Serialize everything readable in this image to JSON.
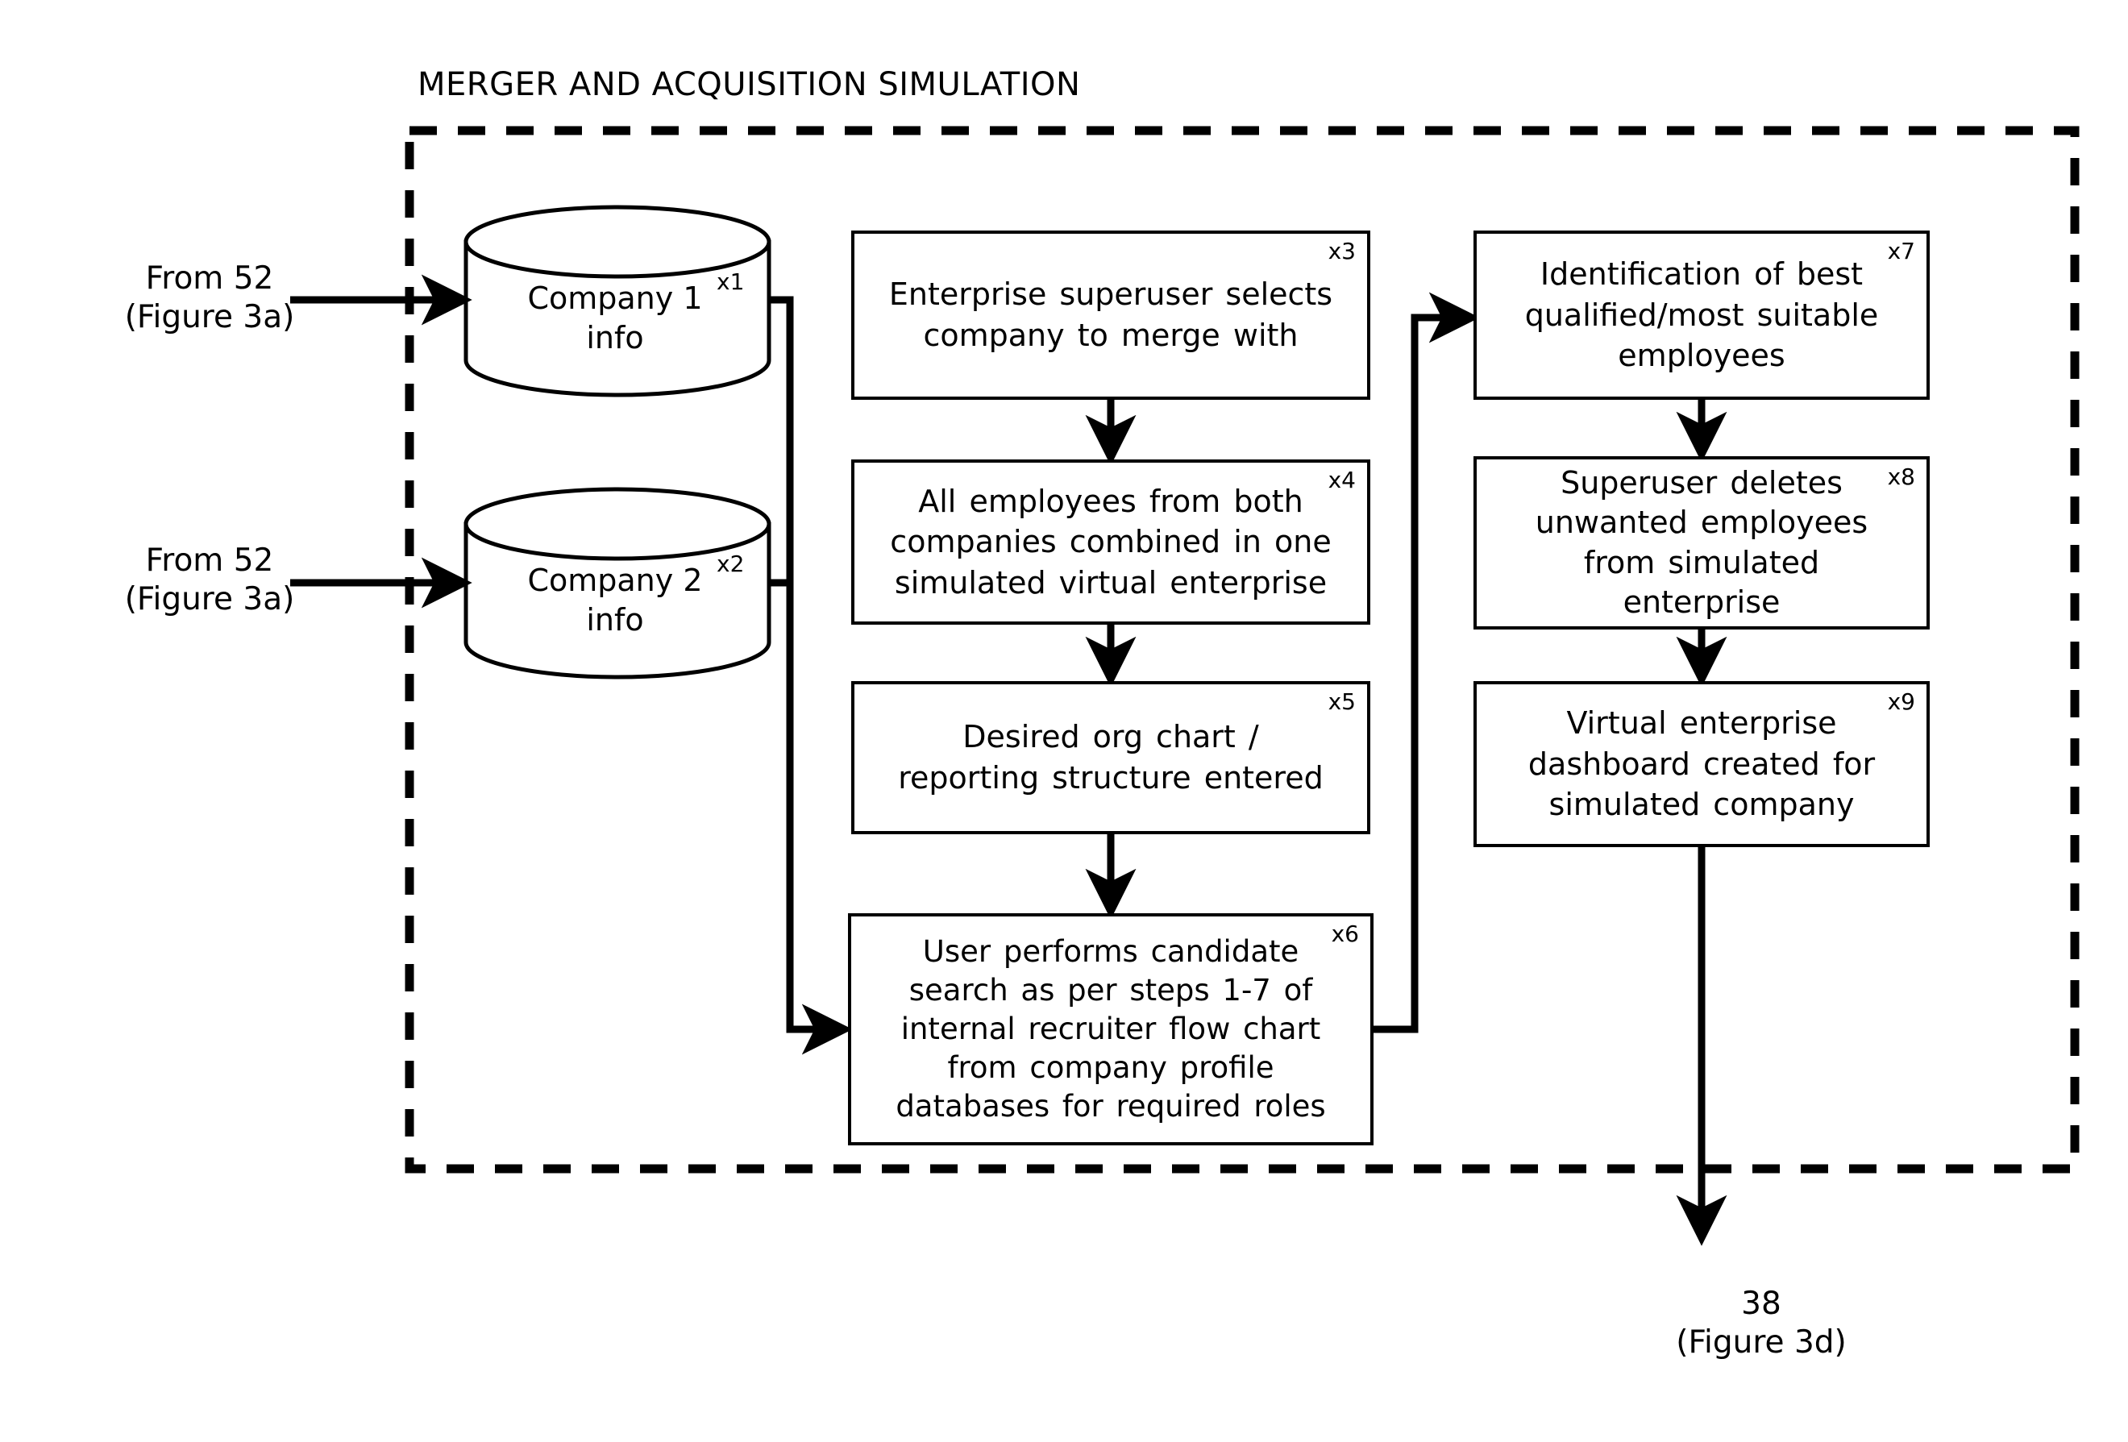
{
  "diagram": {
    "title": "MERGER AND ACQUISITION SIMULATION",
    "type": "flowchart",
    "colors": {
      "line": "#000000",
      "background": "#ffffff",
      "text": "#000000"
    }
  },
  "offpage": {
    "from_top": {
      "line1": "From 52",
      "line2": "(Figure 3a)"
    },
    "from_bottom": {
      "line1": "From 52",
      "line2": "(Figure 3a)"
    },
    "to_next": {
      "line1": "38",
      "line2": "(Figure 3d)"
    }
  },
  "datastores": [
    {
      "id": "x1",
      "ref": "x1",
      "label": "Company 1\ninfo"
    },
    {
      "id": "x2",
      "ref": "x2",
      "label": "Company 2\ninfo"
    }
  ],
  "steps": [
    {
      "id": "x3",
      "ref": "x3",
      "text": "Enterprise superuser selects\ncompany to merge with"
    },
    {
      "id": "x4",
      "ref": "x4",
      "text": "All employees from both\ncompanies combined in one\nsimulated virtual enterprise"
    },
    {
      "id": "x5",
      "ref": "x5",
      "text": "Desired org chart /\nreporting structure entered"
    },
    {
      "id": "x6",
      "ref": "x6",
      "text": "User performs candidate\nsearch as per steps 1-7 of\ninternal recruiter flow chart\nfrom company profile\ndatabases for required roles"
    },
    {
      "id": "x7",
      "ref": "x7",
      "text": "Identification of best\nqualified/most suitable\nemployees"
    },
    {
      "id": "x8",
      "ref": "x8",
      "text": "Superuser deletes\nunwanted employees\nfrom simulated\nenterprise"
    },
    {
      "id": "x9",
      "ref": "x9",
      "text": "Virtual enterprise\ndashboard created for\nsimulated company"
    }
  ]
}
